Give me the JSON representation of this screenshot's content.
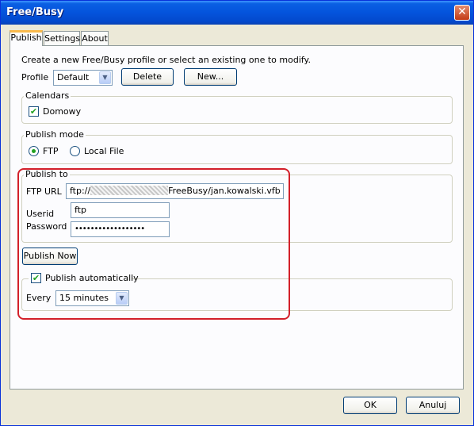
{
  "window": {
    "title": "Free/Busy",
    "close_glyph": "✕"
  },
  "tabs": [
    {
      "label": "Publish",
      "active": true
    },
    {
      "label": "Settings",
      "active": false
    },
    {
      "label": "About",
      "active": false
    }
  ],
  "profile": {
    "instruction": "Create a new Free/Busy profile or select an existing one to modify.",
    "label": "Profile",
    "selected": "Default",
    "delete_label": "Delete",
    "new_label": "New..."
  },
  "calendars": {
    "title": "Calendars",
    "items": [
      {
        "label": "Domowy",
        "checked": true
      }
    ]
  },
  "publish_mode": {
    "title": "Publish mode",
    "options": [
      {
        "label": "FTP",
        "selected": true
      },
      {
        "label": "Local File",
        "selected": false
      }
    ]
  },
  "publish_to": {
    "title": "Publish to",
    "ftp_url_label": "FTP URL",
    "ftp_url_prefix": "ftp://",
    "ftp_url_suffix": "FreeBusy/jan.kowalski.vfb",
    "userid_label": "Userid",
    "userid_value": "ftp",
    "password_label": "Password",
    "password_value": "••••••••••••••••••",
    "publish_now_label": "Publish Now"
  },
  "auto_publish": {
    "label": "Publish automatically",
    "checked": true,
    "every_label": "Every",
    "interval": "15 minutes"
  },
  "footer": {
    "ok_label": "OK",
    "cancel_label": "Anuluj"
  },
  "colors": {
    "titlebar": "#0454dc",
    "dialog_bg": "#ece9d8",
    "annotation": "#d3202a",
    "check": "#21a121"
  }
}
